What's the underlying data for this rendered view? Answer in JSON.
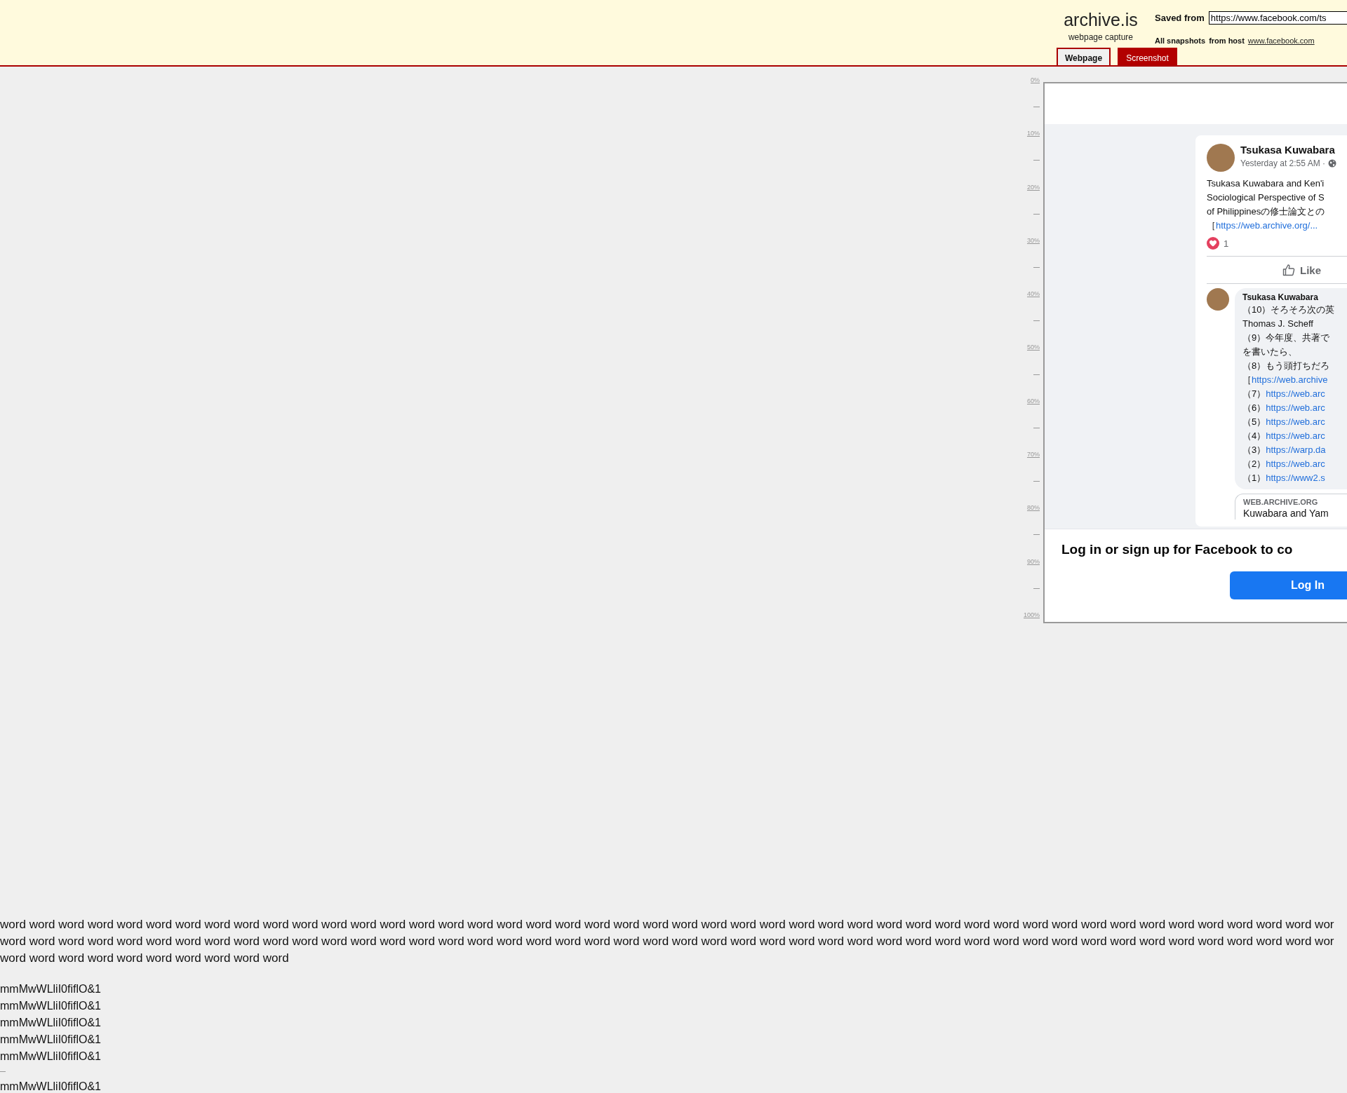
{
  "header": {
    "logo": "archive.is",
    "tagline": "webpage capture",
    "saved_from_label": "Saved from",
    "url": "https://www.facebook.com/ts",
    "all_snapshots": "All snapshots",
    "from_host": "from host",
    "host_link": "www.facebook.com",
    "tabs": [
      {
        "label": "Webpage",
        "selected": true
      },
      {
        "label": "Screenshot",
        "selected": false
      }
    ]
  },
  "ruler": {
    "labels": [
      "0%",
      "10%",
      "20%",
      "30%",
      "40%",
      "50%",
      "60%",
      "70%",
      "80%",
      "90%",
      "100%"
    ]
  },
  "capture": {
    "post": {
      "author": "Tsukasa Kuwabara",
      "time": "Yesterday at 2:55 AM ·",
      "text_lines": [
        "Tsukasa Kuwabara and Ken'i",
        "Sociological Perspective of S",
        "of Philippinesの修士論文との"
      ],
      "link_prefix": "［",
      "link": "https://web.archive.org/...",
      "reactions_count": "1",
      "like": "Like",
      "comment": {
        "author": "Tsukasa Kuwabara",
        "lines": [
          {
            "text": "（10）そろそろ次の英"
          },
          {
            "text": "Thomas J. Scheff"
          },
          {
            "text": "（9）今年度、共著で"
          },
          {
            "text": "を書いたら、"
          },
          {
            "text": "（8）もう頭打ちだろ"
          },
          {
            "text": "［",
            "link": "https://web.archive"
          },
          {
            "text": "（7）",
            "link": "https://web.arc"
          },
          {
            "text": "（6）",
            "link": "https://web.arc"
          },
          {
            "text": "（5）",
            "link": "https://web.arc"
          },
          {
            "text": "（4）",
            "link": "https://web.arc"
          },
          {
            "text": "（3）",
            "link": "https://warp.da"
          },
          {
            "text": "（2）",
            "link": "https://web.arc"
          },
          {
            "text": "（1）",
            "link": "https://www2.s"
          }
        ]
      },
      "preview": {
        "domain": "WEB.ARCHIVE.ORG",
        "title": "Kuwabara and Yam"
      }
    },
    "login": {
      "heading": "Log in or sign up for Facebook to co",
      "button": "Log In"
    }
  },
  "body_text": {
    "paragraph_lines": [
      "word word word word word word word word word word word word word word word word word word word word word word word word word word word word word word word word word word word word word word word word word word word word word wor",
      "word word word word word word word word word word word word word word word word word word word word word word word word word word word word word word word word word word word word word word word word word word word word word wor",
      "word word word word word word word word word word"
    ],
    "samples": [
      "mmMwWLliI0fiflO&1",
      "mmMwWLliI0fiflO&1",
      "mmMwWLliI0fiflO&1",
      "mmMwWLliI0fiflO&1",
      "mmMwWLliI0fiflO&1",
      "mmMwWLliI0fiflO&1"
    ]
  }
}
